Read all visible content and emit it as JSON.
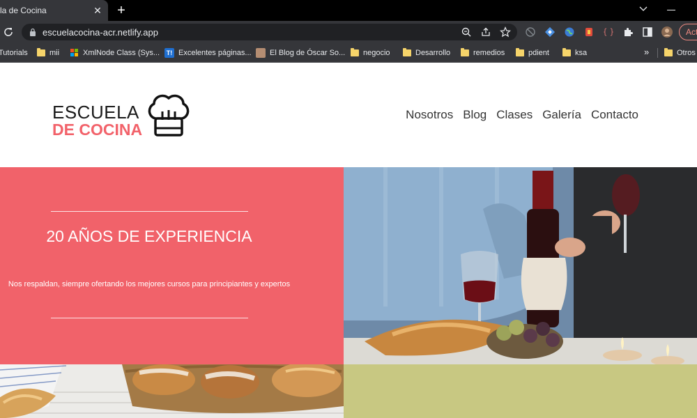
{
  "browser": {
    "tab_title": "la de Cocina",
    "close_symbol": "✕",
    "new_tab_symbol": "+",
    "url": "escuelacocina-acr.netlify.app",
    "action_button_label": "Act"
  },
  "bookmarks": {
    "items": [
      {
        "label": "Tutorials",
        "icon": "none"
      },
      {
        "label": "mii",
        "icon": "folder-icon"
      },
      {
        "label": "XmlNode Class (Sys...",
        "icon": "microsoft-icon"
      },
      {
        "label": "Excelentes páginas...",
        "icon": "t-logo-icon"
      },
      {
        "label": "El Blog de Óscar So...",
        "icon": "avatar-icon"
      },
      {
        "label": "negocio",
        "icon": "folder-icon"
      },
      {
        "label": "Desarrollo",
        "icon": "folder-icon"
      },
      {
        "label": "remedios",
        "icon": "folder-icon"
      },
      {
        "label": "pdient",
        "icon": "folder-icon"
      },
      {
        "label": "ksa",
        "icon": "folder-icon"
      }
    ],
    "more_symbol": "»",
    "other_label": "Otros"
  },
  "site": {
    "logo": {
      "line1": "ESCUELA",
      "line2": "DE COCINA"
    },
    "nav": [
      "Nosotros",
      "Blog",
      "Clases",
      "Galería",
      "Contacto"
    ],
    "hero": {
      "title": "20 AÑOS DE EXPERIENCIA",
      "text": "Nos respaldan, siempre ofertando los mejores cursos para principiantes y expertos"
    },
    "colors": {
      "accent": "#f1626a",
      "olive": "#c8c882",
      "text": "#333333"
    }
  }
}
